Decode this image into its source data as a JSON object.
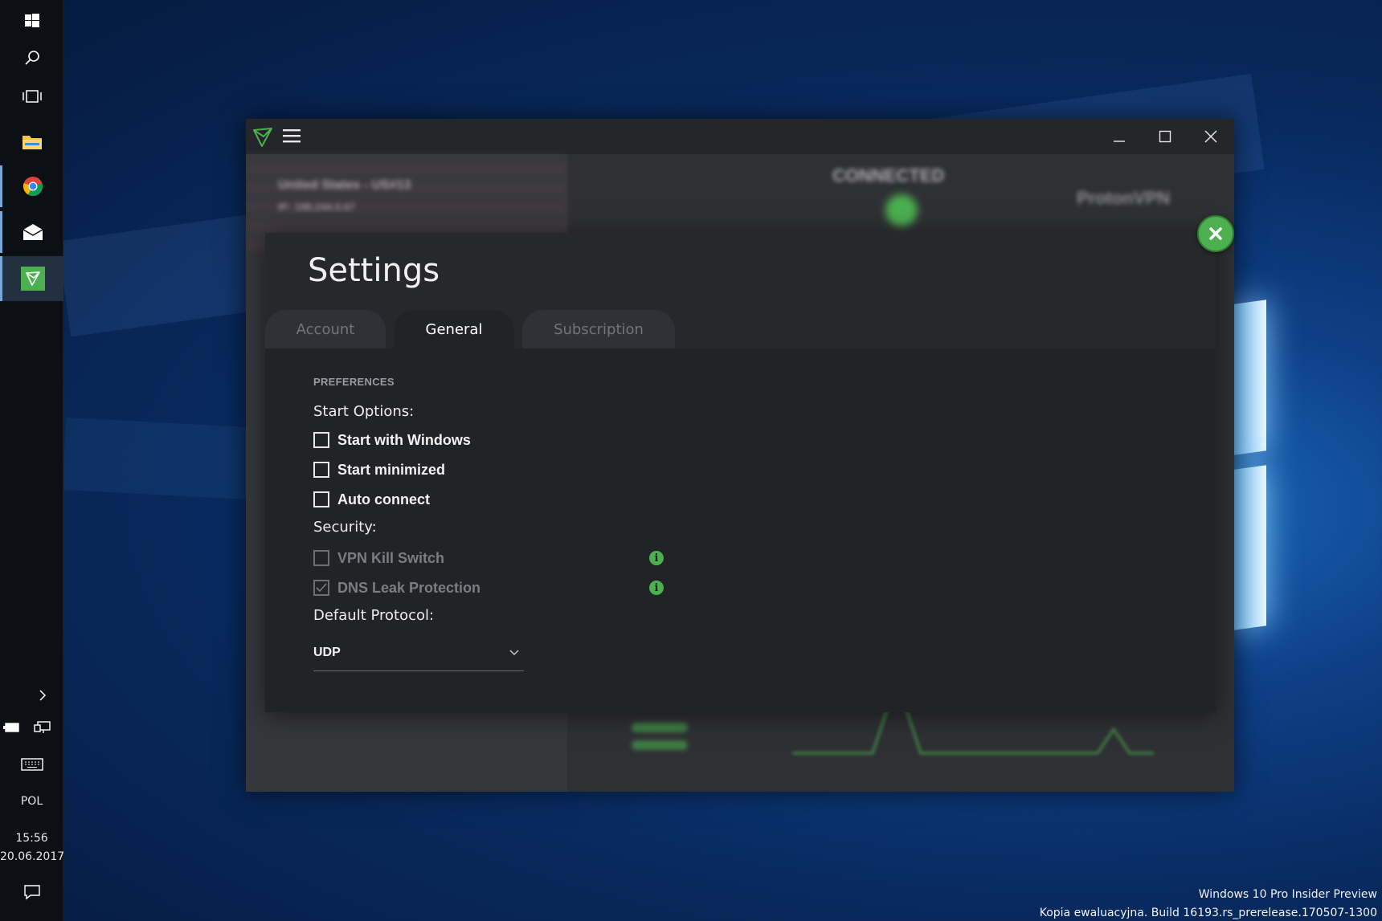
{
  "taskbar": {
    "language": "POL",
    "time": "15:56",
    "date": "20.06.2017",
    "icons": [
      "windows-start-icon",
      "search-icon",
      "task-view-icon",
      "file-explorer-icon",
      "chrome-icon",
      "mail-icon",
      "protonvpn-icon",
      "chevron-right-icon",
      "battery-icon",
      "network-icon",
      "keyboard-icon",
      "action-center-icon"
    ]
  },
  "window": {
    "background_status": "CONNECTED",
    "background_brand": "ProtonVPN",
    "background_server": "United States - US#13",
    "background_ip": "IP: 198.244.0.67"
  },
  "settings": {
    "title": "Settings",
    "tabs": [
      {
        "label": "Account",
        "active": false
      },
      {
        "label": "General",
        "active": true
      },
      {
        "label": "Subscription",
        "active": false
      }
    ],
    "section_heading": "PREFERENCES",
    "start_options_label": "Start Options:",
    "start_options": [
      {
        "label": "Start with Windows",
        "checked": false
      },
      {
        "label": "Start minimized",
        "checked": false
      },
      {
        "label": "Auto connect",
        "checked": false
      }
    ],
    "security_label": "Security:",
    "security_options": [
      {
        "label": "VPN Kill Switch",
        "checked": false,
        "disabled": true
      },
      {
        "label": "DNS Leak Protection",
        "checked": true,
        "disabled": true
      }
    ],
    "protocol_label": "Default Protocol:",
    "protocol_value": "UDP"
  },
  "watermark": {
    "line1": "Windows 10 Pro Insider Preview",
    "line2": "Kopia ewaluacyjna. Build 16193.rs_prerelease.170507-1300"
  },
  "colors": {
    "accent": "#4caf50",
    "modal_bg": "#27282c",
    "content_bg": "#222327"
  }
}
